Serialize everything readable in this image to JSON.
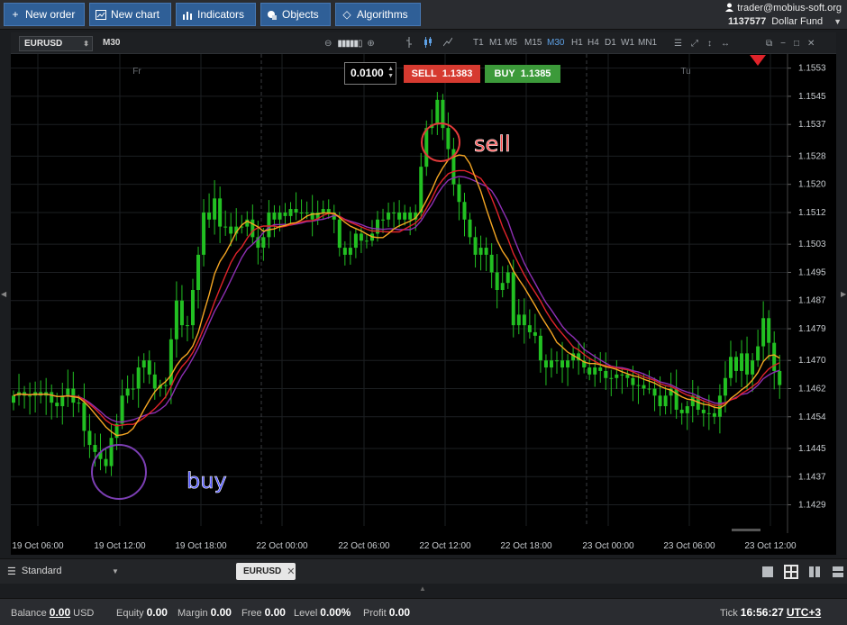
{
  "toolbar": {
    "new_order": "New order",
    "new_chart": "New chart",
    "indicators": "Indicators",
    "objects": "Objects",
    "algorithms": "Algorithms"
  },
  "account": {
    "user": "trader@mobius-soft.org",
    "number": "1137577",
    "name": "Dollar Fund"
  },
  "chart_header": {
    "symbol": "EURUSD",
    "timeframe": "M30",
    "timeframes": [
      "T1",
      "M1",
      "M5",
      "M15",
      "M30",
      "H1",
      "H4",
      "D1",
      "W1",
      "MN1"
    ],
    "active_timeframe": "M30"
  },
  "trade": {
    "lot": "0.0100",
    "sell_label": "SELL",
    "sell_price": "1.1383",
    "buy_label": "BUY",
    "buy_price": "1.1385",
    "sell_color": "#d63a30",
    "buy_color": "#3c9a3a"
  },
  "chart_data": {
    "type": "candlestick",
    "y_ticks": [
      "1.1553",
      "1.1545",
      "1.1537",
      "1.1528",
      "1.1520",
      "1.1512",
      "1.1503",
      "1.1495",
      "1.1487",
      "1.1479",
      "1.1470",
      "1.1462",
      "1.1454",
      "1.1445",
      "1.1437",
      "1.1429"
    ],
    "ylim": [
      1.1423,
      1.1557
    ],
    "x_ticks": [
      "19 Oct 06:00",
      "19 Oct 12:00",
      "19 Oct 18:00",
      "22 Oct 00:00",
      "22 Oct 06:00",
      "22 Oct 12:00",
      "22 Oct 18:00",
      "23 Oct 00:00",
      "23 Oct 06:00",
      "23 Oct 12:00"
    ],
    "day_labels": [
      "Fr",
      "Tu"
    ],
    "annotations": {
      "sell": "sell",
      "buy": "buy"
    },
    "candle_colors": {
      "up": "#22c022",
      "down": "#22c022"
    },
    "ma_colors": {
      "red": "#e0232a",
      "orange": "#f5a623",
      "purple": "#8e2fb4"
    },
    "closes": [
      1.146,
      1.1461,
      1.146,
      1.146,
      1.1461,
      1.146,
      1.1461,
      1.1458,
      1.1457,
      1.146,
      1.1462,
      1.1458,
      1.1458,
      1.145,
      1.1446,
      1.1444,
      1.1442,
      1.144,
      1.1448,
      1.1452,
      1.146,
      1.1462,
      1.1462,
      1.1468,
      1.147,
      1.1466,
      1.1462,
      1.1463,
      1.1463,
      1.1476,
      1.1487,
      1.148,
      1.148,
      1.149,
      1.15,
      1.1512,
      1.151,
      1.1516,
      1.1508,
      1.1508,
      1.1506,
      1.1508,
      1.1508,
      1.151,
      1.1505,
      1.1502,
      1.1505,
      1.1512,
      1.151,
      1.1512,
      1.1511,
      1.1513,
      1.1512,
      1.1512,
      1.1512,
      1.151,
      1.1512,
      1.1513,
      1.1512,
      1.151,
      1.1502,
      1.15,
      1.1502,
      1.1506,
      1.1504,
      1.1504,
      1.1506,
      1.151,
      1.151,
      1.1512,
      1.1512,
      1.151,
      1.1512,
      1.151,
      1.1512,
      1.1525,
      1.1536,
      1.1537,
      1.1544,
      1.1536,
      1.153,
      1.152,
      1.1515,
      1.151,
      1.1505,
      1.15,
      1.1502,
      1.15,
      1.1495,
      1.149,
      1.1492,
      1.1495,
      1.148,
      1.1483,
      1.148,
      1.1478,
      1.1477,
      1.147,
      1.1468,
      1.147,
      1.147,
      1.1468,
      1.147,
      1.1472,
      1.147,
      1.1468,
      1.1466,
      1.1468,
      1.1467,
      1.1465,
      1.1465,
      1.1466,
      1.1466,
      1.1465,
      1.1463,
      1.1463,
      1.1462,
      1.1462,
      1.146,
      1.1457,
      1.146,
      1.1462,
      1.1456,
      1.1455,
      1.1457,
      1.146,
      1.1456,
      1.1455,
      1.1455,
      1.1454,
      1.146,
      1.1465,
      1.1471,
      1.1467,
      1.1472,
      1.1466,
      1.147,
      1.1474,
      1.1482,
      1.1475,
      1.1467,
      1.1463
    ]
  },
  "bottom": {
    "layout_name": "Standard",
    "chart_tab": "EURUSD"
  },
  "status": {
    "balance_label": "Balance",
    "balance_value": "0.00",
    "balance_currency": "USD",
    "equity_label": "Equity",
    "equity_value": "0.00",
    "margin_label": "Margin",
    "margin_value": "0.00",
    "free_label": "Free",
    "free_value": "0.00",
    "level_label": "Level",
    "level_value": "0.00%",
    "profit_label": "Profit",
    "profit_value": "0.00",
    "tick_label": "Tick",
    "tick_time": "16:56:27",
    "timezone": "UTC+3"
  }
}
